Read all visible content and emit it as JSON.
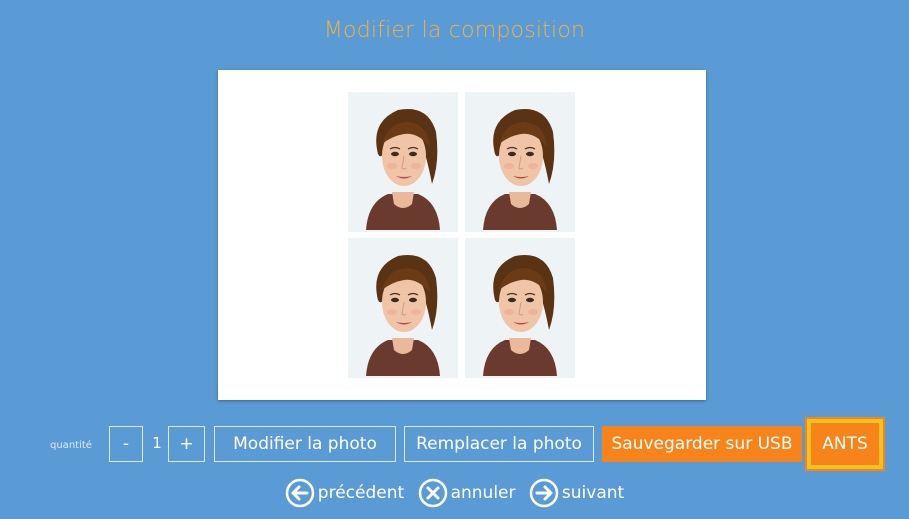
{
  "header": {
    "title": "Modifier la composition"
  },
  "toolbar": {
    "quantity_label": "quantité",
    "minus_label": "-",
    "quantity_value": "1",
    "plus_label": "+",
    "modify_photo_label": "Modifier la photo",
    "replace_photo_label": "Remplacer la photo",
    "save_usb_label": "Sauvegarder sur USB",
    "ants_label": "ANTS"
  },
  "nav": {
    "previous_label": "précédent",
    "cancel_label": "annuler",
    "next_label": "suivant"
  },
  "colors": {
    "background": "#5b9bd5",
    "title": "#f5b042",
    "accent_orange": "#f7831b",
    "ants_highlight": "#f5c21b"
  },
  "composition": {
    "photo_count": 4,
    "layout": "2x2 grid"
  }
}
